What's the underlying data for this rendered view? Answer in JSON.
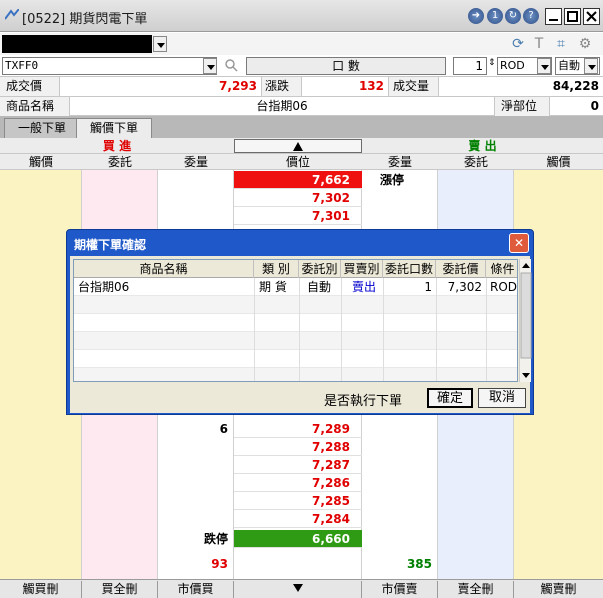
{
  "window": {
    "title": "[0522] 期貨閃電下單",
    "buttons": [
      "arrow-right-circle-icon",
      "info-circle-icon",
      "refresh-circle-icon",
      "help-circle-icon",
      "minimize-icon",
      "maximize-icon",
      "close-icon"
    ]
  },
  "toolbar": {
    "tool_icons": [
      "refresh-icon",
      "text-icon",
      "layout-icon",
      "gear-icon"
    ]
  },
  "order_bar": {
    "symbol": "TXFF0",
    "lots_label": "口 數",
    "quantity": "1",
    "order_type": "ROD",
    "mode": "自動"
  },
  "quote": {
    "last_price_label": "成交價",
    "last_price": "7,293",
    "change_label": "漲跌",
    "change": "132",
    "volume_label": "成交量",
    "volume": "84,228",
    "product_label": "商品名稱",
    "product_name": "台指期06",
    "net_position_label": "淨部位",
    "net_position": "0"
  },
  "tabs": [
    {
      "label": "一般下單"
    },
    {
      "label": "觸價下單"
    }
  ],
  "ladder": {
    "buy_title": "買 進",
    "sell_title": "賣 出",
    "columns": [
      "觸價",
      "委託",
      "委量",
      "價位",
      "委量",
      "委託",
      "觸價"
    ],
    "upper_prices": [
      "7,662",
      "7,302",
      "7,301"
    ],
    "limit_up_label": "漲停",
    "lower_prices": [
      "7,289",
      "7,288",
      "7,287",
      "7,286",
      "7,285",
      "7,284",
      "6,660"
    ],
    "bid_qty_7289": "6",
    "limit_down_label": "跌停",
    "total_bid_qty": "93",
    "total_ask_qty": "385"
  },
  "bottom_buttons": [
    "觸買刪",
    "買全刪",
    "市價買",
    "市價賣",
    "賣全刪",
    "觸賣刪"
  ],
  "dialog": {
    "title": "期權下單確認",
    "columns": [
      "商品名稱",
      "類 別",
      "委託別",
      "買賣別",
      "委託口數",
      "委託價",
      "條件"
    ],
    "row": {
      "product": "台指期06",
      "category": "期 貨",
      "order_kind": "自動",
      "side": "賣出",
      "qty": "1",
      "price": "7,302",
      "condition": "ROD"
    },
    "question": "是否執行下單",
    "confirm_label": "確定",
    "cancel_label": "取消"
  }
}
